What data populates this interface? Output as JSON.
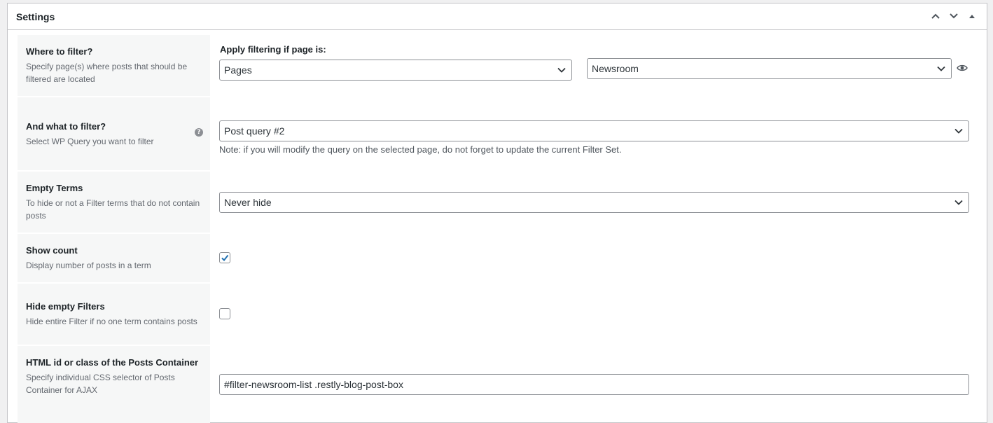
{
  "panel": {
    "title": "Settings"
  },
  "settings": {
    "where": {
      "title": "Where to filter?",
      "description": "Specify page(s) where posts that should be filtered are located",
      "heading": "Apply filtering if page is:",
      "page_type": "Pages",
      "page": "Newsroom"
    },
    "what": {
      "title": "And what to filter?",
      "description": "Select WP Query you want to filter",
      "query": "Post query #2",
      "note": "Note: if you will modify the query on the selected page, do not forget to update the current Filter Set."
    },
    "empty_terms": {
      "title": "Empty Terms",
      "description": "To hide or not a Filter terms that do not contain posts",
      "value": "Never hide"
    },
    "show_count": {
      "title": "Show count",
      "description": "Display number of posts in a term",
      "checked": true
    },
    "hide_empty_filters": {
      "title": "Hide empty Filters",
      "description": "Hide entire Filter if no one term contains posts",
      "checked": false
    },
    "posts_container": {
      "title": "HTML id or class of the Posts Container",
      "description": "Specify individual CSS selector of Posts Container for AJAX",
      "value": "#filter-newsroom-list .restly-blog-post-box"
    }
  },
  "icons": {
    "move_up": "chevron-up-icon",
    "move_down": "chevron-down-icon",
    "toggle": "triangle-up-icon",
    "help": "question-mark-icon",
    "preview": "eye-icon",
    "check": "checkmark-icon"
  },
  "colors": {
    "accent": "#2271b1",
    "border": "#c3c4c7",
    "label_bg": "#f6f7f7"
  }
}
